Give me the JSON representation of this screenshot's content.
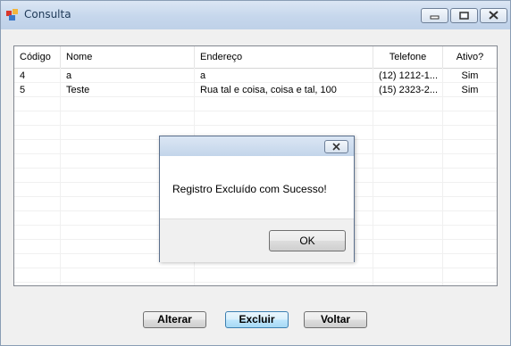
{
  "window": {
    "title": "Consulta",
    "app_icon": "form-app-icon"
  },
  "grid": {
    "columns": [
      "Código",
      "Nome",
      "Endereço",
      "Telefone",
      "Ativo?"
    ],
    "rows": [
      [
        "4",
        "a",
        "a",
        "(12) 1212-1...",
        "Sim"
      ],
      [
        "5",
        "Teste",
        "Rua tal e coisa, coisa e tal, 100",
        "(15) 2323-2...",
        "Sim"
      ]
    ]
  },
  "buttons": {
    "alterar": "Alterar",
    "excluir": "Excluir",
    "voltar": "Voltar"
  },
  "dialog": {
    "message": "Registro Excluído com Sucesso!",
    "ok_label": "OK",
    "close_icon": "close-icon"
  }
}
